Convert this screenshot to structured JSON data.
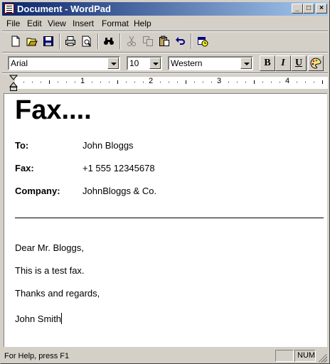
{
  "window": {
    "title": "Document - WordPad"
  },
  "menu": [
    "File",
    "Edit",
    "View",
    "Insert",
    "Format",
    "Help"
  ],
  "toolbar": [
    {
      "name": "new-icon"
    },
    {
      "name": "open-icon"
    },
    {
      "name": "save-icon"
    },
    {
      "name": "print-icon"
    },
    {
      "name": "print-preview-icon"
    },
    {
      "name": "find-icon"
    },
    {
      "name": "cut-icon"
    },
    {
      "name": "copy-icon"
    },
    {
      "name": "paste-icon"
    },
    {
      "name": "undo-icon"
    },
    {
      "name": "date-time-icon"
    }
  ],
  "format": {
    "font": "Arial",
    "size": "10",
    "script": "Western",
    "bold": "B",
    "italic": "I",
    "underline": "U"
  },
  "ruler": [
    "1",
    "2",
    "3",
    "4"
  ],
  "document": {
    "heading": "Fax....",
    "fields": [
      {
        "label": "To:",
        "value": "John Bloggs"
      },
      {
        "label": "Fax:",
        "value": "+1 555 12345678"
      },
      {
        "label": "Company:",
        "value": "JohnBloggs & Co."
      }
    ],
    "body": [
      "Dear Mr. Bloggs,",
      "This is a test fax.",
      "Thanks and regards,",
      "John Smith"
    ]
  },
  "status": {
    "help": "For Help, press F1",
    "num": "NUM"
  }
}
